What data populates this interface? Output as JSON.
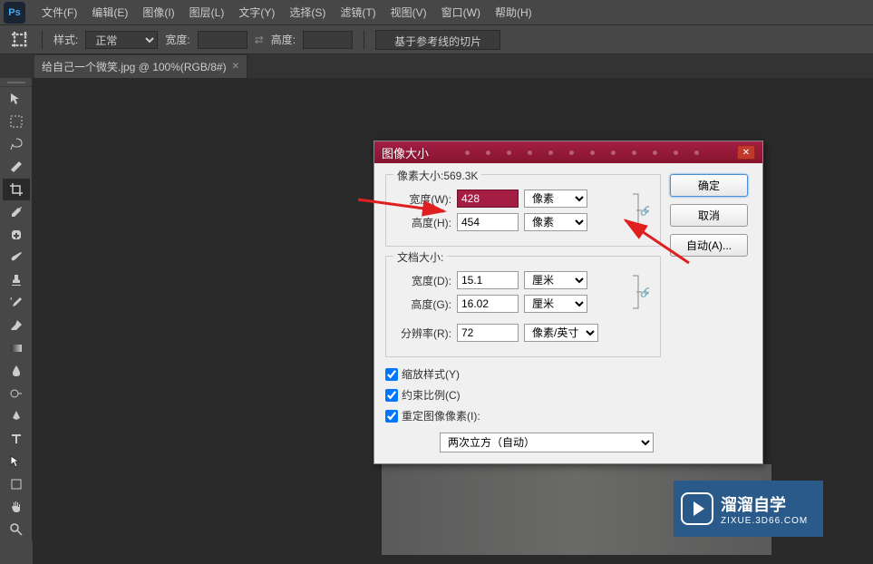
{
  "menu": {
    "items": [
      "文件(F)",
      "编辑(E)",
      "图像(I)",
      "图层(L)",
      "文字(Y)",
      "选择(S)",
      "滤镜(T)",
      "视图(V)",
      "窗口(W)",
      "帮助(H)"
    ]
  },
  "options": {
    "style_label": "样式:",
    "style_value": "正常",
    "width_label": "宽度:",
    "height_label": "高度:",
    "slice_button": "基于参考线的切片"
  },
  "tab": {
    "title": "给自己一个微笑.jpg @ 100%(RGB/8#)"
  },
  "dialog": {
    "title": "图像大小",
    "pixel_size_label": "像素大小:569.3K",
    "width_label": "宽度(W):",
    "width_value": "428",
    "height_label": "高度(H):",
    "height_value": "454",
    "pixel_unit": "像素",
    "doc_size_label": "文档大小:",
    "doc_width_label": "宽度(D):",
    "doc_width_value": "15.1",
    "doc_height_label": "高度(G):",
    "doc_height_value": "16.02",
    "cm_unit": "厘米",
    "resolution_label": "分辨率(R):",
    "resolution_value": "72",
    "resolution_unit": "像素/英寸",
    "scale_styles": "缩放样式(Y)",
    "constrain": "约束比例(C)",
    "resample": "重定图像像素(I):",
    "resample_method": "两次立方（自动）",
    "ok": "确定",
    "cancel": "取消",
    "auto": "自动(A)..."
  },
  "watermark": {
    "title": "溜溜自学",
    "sub": "ZIXUE.3D66.COM"
  }
}
